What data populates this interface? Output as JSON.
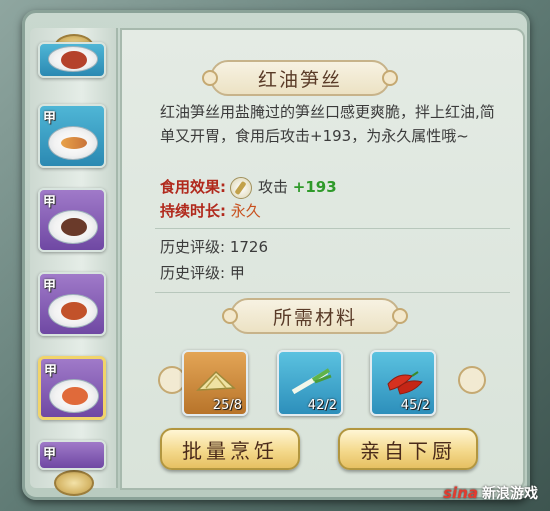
{
  "recipe": {
    "title": "红油笋丝",
    "description": "红油笋丝用盐腌过的笋丝口感更爽脆，拌上红油,简单又开胃，食用后攻击+193，为永久属性哦~"
  },
  "effect": {
    "label": "食用效果:",
    "stat": "攻击",
    "value": "+193"
  },
  "duration": {
    "label": "持续时长:",
    "value": "永久"
  },
  "history": [
    {
      "label": "历史评级:",
      "value": "1726"
    },
    {
      "label": "历史评级:",
      "value": "甲"
    }
  ],
  "materials": {
    "title": "所需材料",
    "items": [
      {
        "count": "25/8",
        "icon": "bamboo-shoot-icon"
      },
      {
        "count": "42/2",
        "icon": "scallion-icon"
      },
      {
        "count": "45/2",
        "icon": "chili-pepper-icon"
      }
    ]
  },
  "tabs": [
    {
      "grade": ""
    },
    {
      "grade": "甲"
    },
    {
      "grade": "甲"
    },
    {
      "grade": "甲"
    },
    {
      "grade": "甲"
    },
    {
      "grade": "甲"
    }
  ],
  "buttons": {
    "batch_cook": "批量烹饪",
    "cook_self": "亲自下厨"
  },
  "watermark": {
    "logo": "sina",
    "text": "新浪游戏"
  }
}
